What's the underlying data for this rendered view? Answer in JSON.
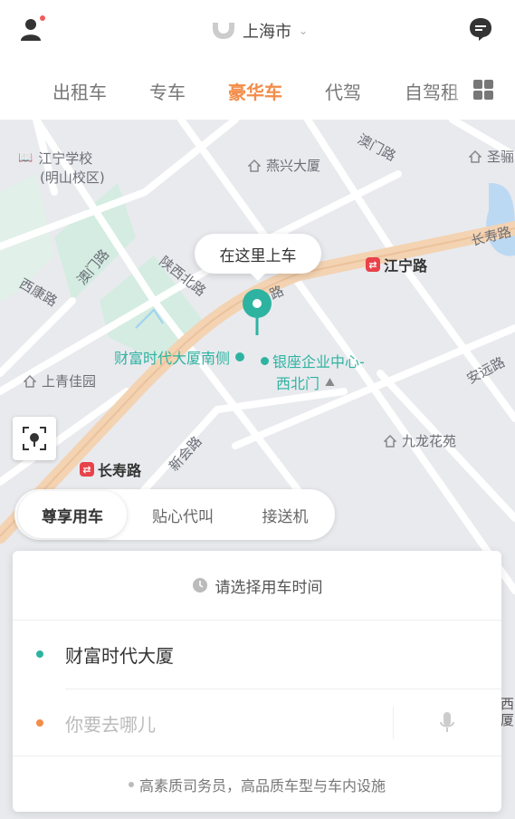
{
  "header": {
    "city": "上海市",
    "tabs": [
      "出租车",
      "专车",
      "豪华车",
      "代驾",
      "自驾租"
    ],
    "active_tab_index": 2
  },
  "map": {
    "pickup_bubble": "在这里上车",
    "pickup_poi": "财富时代大厦南侧",
    "labels": {
      "school_line1": "江宁学校",
      "school_line2": "(明山校区)",
      "yanxing": "燕兴大厦",
      "aomen": "澳门路",
      "sheng": "圣骊",
      "changshou_road_right": "长寿路",
      "jiangning_road": "江宁路",
      "aomen_road_left": "澳门路",
      "shaanxi_bei": "陕西北路",
      "xikang": "西康路",
      "lu": "路",
      "yinzuo_line1": "银座企业中心-",
      "yinzuo_line2": "西北门",
      "shangqing": "上青佳园",
      "anyuan": "安远路",
      "jiulong": "九龙花苑",
      "xinhui": "新会路",
      "changshou_road_left": "长寿路",
      "right_edge_line1": "西",
      "right_edge_line2": "厦"
    }
  },
  "service_tabs": [
    "尊享用车",
    "贴心代叫",
    "接送机"
  ],
  "booking": {
    "time_prompt": "请选择用车时间",
    "origin": "财富时代大厦",
    "destination_placeholder": "你要去哪儿",
    "tip": "高素质司务员，高品质车型与车内设施"
  },
  "colors": {
    "accent_orange": "#f28d4a",
    "teal": "#2fb3a1",
    "origin_dot": "#2fb3a1",
    "destination_dot": "#f28d4a"
  }
}
